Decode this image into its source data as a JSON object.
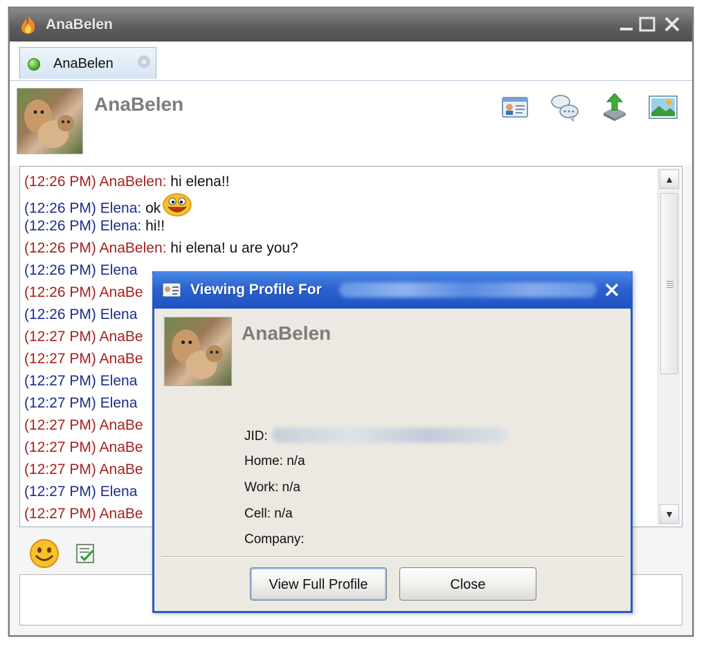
{
  "window": {
    "title": "AnaBelen"
  },
  "tab": {
    "label": "AnaBelen"
  },
  "contact": {
    "name": "AnaBelen"
  },
  "header_icons": [
    "contact-card-icon",
    "chat-bubbles-icon",
    "send-file-icon",
    "picture-icon"
  ],
  "messages": [
    {
      "who": "her",
      "meta": "(12:26 PM) AnaBelen:",
      "text": " hi elena!!"
    },
    {
      "who": "me",
      "meta": "(12:26 PM) Elena:",
      "text": " ok",
      "emoticon": "smiley"
    },
    {
      "who": "me",
      "meta": "(12:26 PM) Elena:",
      "text": " hi!!"
    },
    {
      "who": "her",
      "meta": "(12:26 PM) AnaBelen:",
      "text": " hi elena! u are you?"
    },
    {
      "who": "me",
      "meta": "(12:26 PM) Elena",
      "text": ""
    },
    {
      "who": "her",
      "meta": "(12:26 PM) AnaBe",
      "text": ""
    },
    {
      "who": "me",
      "meta": "(12:26 PM) Elena",
      "text": ""
    },
    {
      "who": "her",
      "meta": "(12:27 PM) AnaBe",
      "text": ""
    },
    {
      "who": "her",
      "meta": "(12:27 PM) AnaBe",
      "text": ""
    },
    {
      "who": "me",
      "meta": "(12:27 PM) Elena",
      "text": ""
    },
    {
      "who": "me",
      "meta": "(12:27 PM) Elena",
      "text": ""
    },
    {
      "who": "her",
      "meta": "(12:27 PM) AnaBe",
      "text": ""
    },
    {
      "who": "her",
      "meta": "(12:27 PM) AnaBe",
      "text": ""
    },
    {
      "who": "her",
      "meta": "(12:27 PM) AnaBe",
      "text": ""
    },
    {
      "who": "me",
      "meta": "(12:27 PM) Elena",
      "text": ""
    },
    {
      "who": "her",
      "meta": "(12:27 PM) AnaBe",
      "text": ""
    }
  ],
  "toolbar": {
    "icons": [
      "emoticon-icon",
      "spellcheck-icon"
    ]
  },
  "dialog": {
    "title": "Viewing Profile For",
    "name": "AnaBelen",
    "jid_label": "JID:",
    "home": "Home: n/a",
    "work": "Work: n/a",
    "cell": "Cell: n/a",
    "company": "Company:",
    "view_full_profile_label": "View Full Profile",
    "close_label": "Close"
  },
  "colors": {
    "her_meta": "#a52020",
    "me_meta": "#1c2c8a",
    "dialog_title": "#2c62cf"
  }
}
